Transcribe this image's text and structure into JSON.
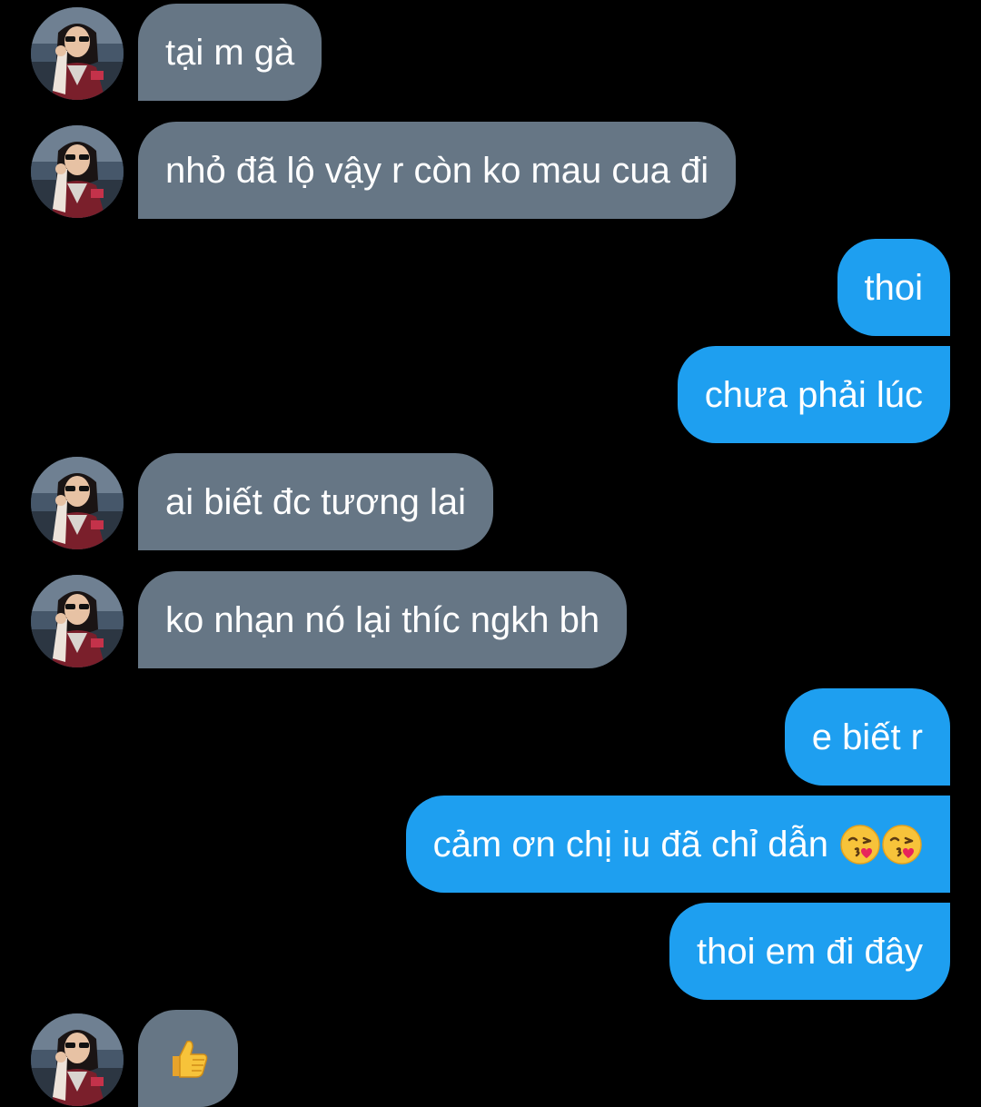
{
  "colors": {
    "background": "#000000",
    "incoming_bubble": "#667685",
    "outgoing_bubble": "#1e9ff0",
    "bubble_text": "#ffffff"
  },
  "messages": [
    {
      "side": "incoming",
      "text": "tại m gà"
    },
    {
      "side": "incoming",
      "text": "nhỏ đã lộ vậy r còn ko mau cua đi"
    },
    {
      "side": "outgoing",
      "text": "thoi"
    },
    {
      "side": "outgoing",
      "text": "chưa phải lúc"
    },
    {
      "side": "incoming",
      "text": "ai biết đc tương lai"
    },
    {
      "side": "incoming",
      "text": "ko nhạn nó lại thíc ngkh bh"
    },
    {
      "side": "outgoing",
      "text": "e biết r"
    },
    {
      "side": "outgoing",
      "text": "cảm ơn chị iu đã chỉ dẫn",
      "emoji": [
        "face-blowing-kiss-icon",
        "face-blowing-kiss-icon"
      ]
    },
    {
      "side": "outgoing",
      "text": "thoi em đi đây"
    },
    {
      "side": "incoming",
      "emoji": [
        "thumbs-up-icon"
      ]
    }
  ]
}
